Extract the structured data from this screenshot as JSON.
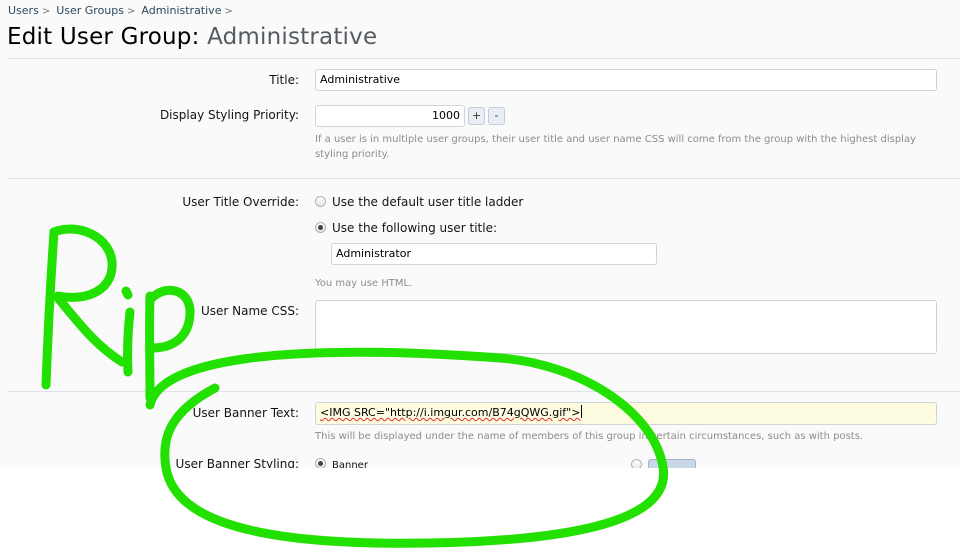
{
  "breadcrumb": {
    "items": [
      "Users",
      "User Groups",
      "Administrative"
    ],
    "separator": ">"
  },
  "page": {
    "title": "Edit User Group:",
    "subtitle": "Administrative"
  },
  "form": {
    "title_label": "Title:",
    "title_value": "Administrative",
    "priority_label": "Display Styling Priority:",
    "priority_value": "1000",
    "increment_label": "+",
    "decrement_label": "-",
    "priority_hint": "If a user is in multiple user groups, their user title and user name CSS will come from the group with the highest display styling priority.",
    "title_override_label": "User Title Override:",
    "option_default": "Use the default user title ladder",
    "option_custom": "Use the following user title:",
    "custom_title_value": "Administrator",
    "html_hint": "You may use HTML.",
    "name_css_label": "User Name CSS:",
    "name_css_value": "",
    "banner_text_label": "User Banner Text:",
    "banner_text_value": "<IMG SRC=\"http://i.imgur.com/B74gQWG.gif\">",
    "banner_text_hint": "This will be displayed under the name of members of this group in certain circumstances, such as with posts.",
    "banner_styling_label": "User Banner Styling:",
    "banner_option_label": "Banner"
  },
  "annotation": {
    "handwritten_text": "Rip",
    "ink_color": "#22e000"
  },
  "colors": {
    "link": "#2b485c",
    "highlight_field": "#fdfbe0",
    "muted_text": "#8c8c8c"
  }
}
